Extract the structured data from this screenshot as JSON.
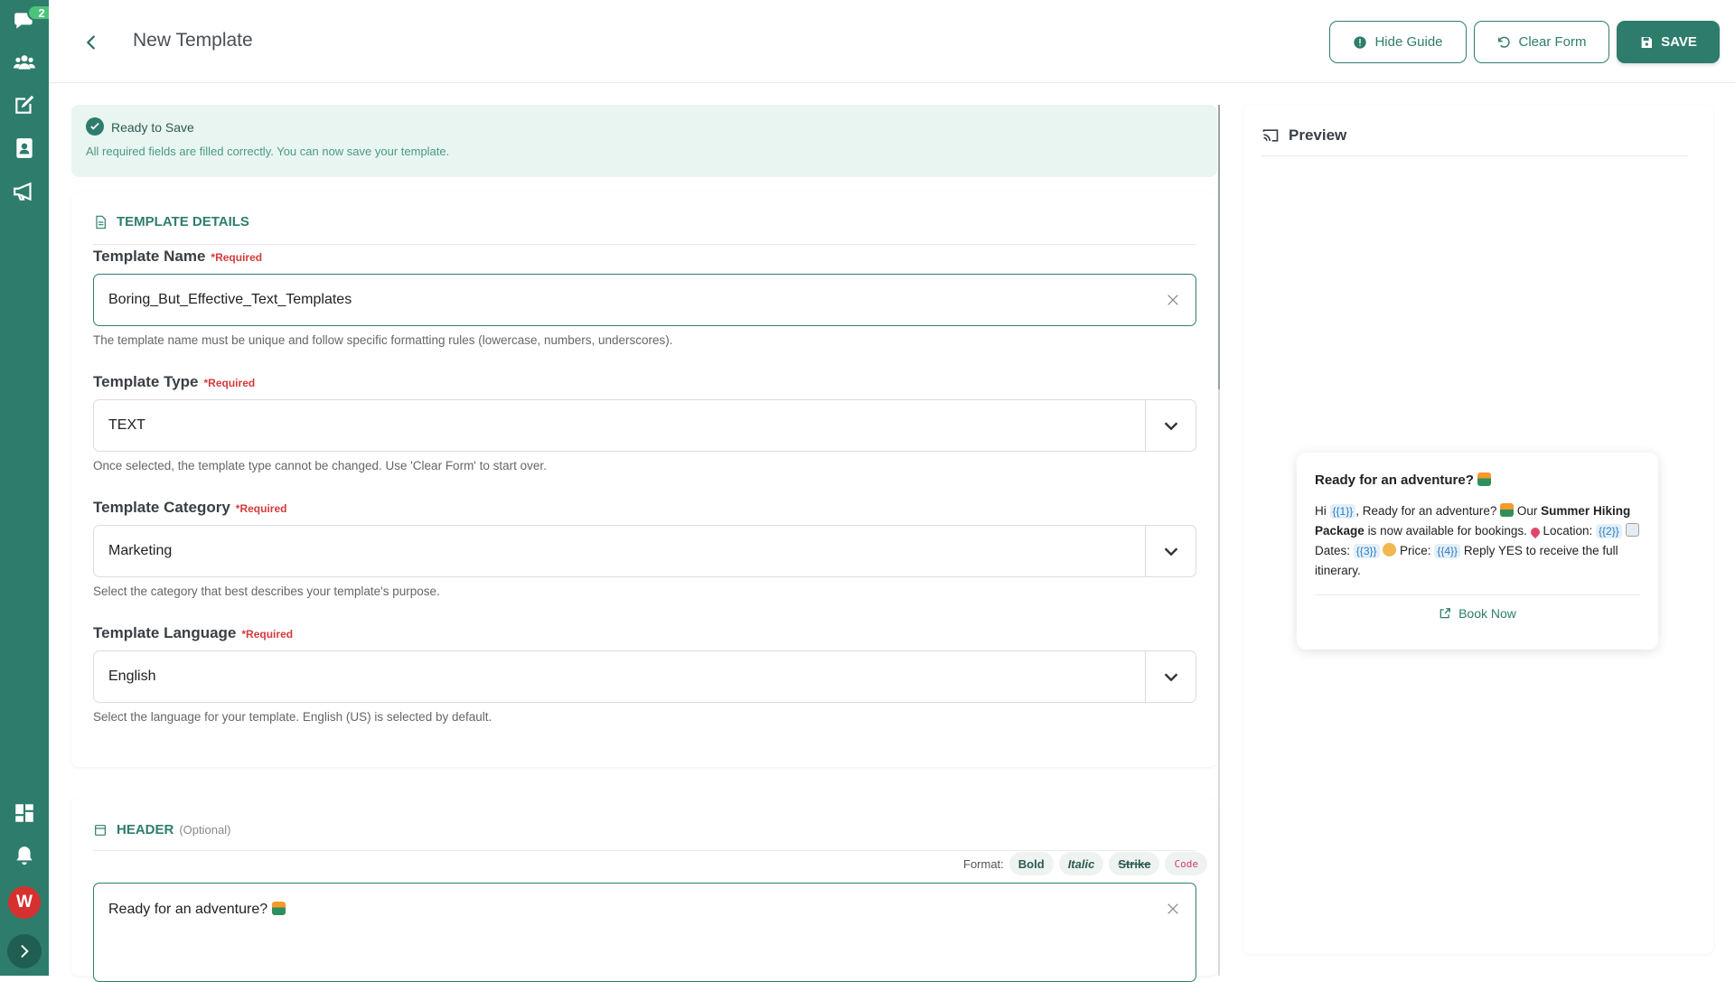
{
  "sidebar": {
    "chat_badge": "2",
    "avatar_letter": "W",
    "items": [
      {
        "icon": "chat-icon"
      },
      {
        "icon": "users-icon"
      },
      {
        "icon": "edit-icon"
      },
      {
        "icon": "contact-icon"
      },
      {
        "icon": "megaphone-icon"
      },
      {
        "icon": "dashboard-icon"
      },
      {
        "icon": "bell-icon"
      }
    ]
  },
  "header": {
    "title": "New Template",
    "hide_guide": "Hide Guide",
    "clear_form": "Clear Form",
    "save": "SAVE"
  },
  "status": {
    "title": "Ready to Save",
    "message": "All required fields are filled correctly. You can now save your template."
  },
  "details": {
    "section_title": "TEMPLATE DETAILS",
    "name": {
      "label": "Template Name",
      "required": "*Required",
      "value": "Boring_But_Effective_Text_Templates",
      "help": "The template name must be unique and follow specific formatting rules (lowercase, numbers, underscores)."
    },
    "type": {
      "label": "Template Type",
      "required": "*Required",
      "value": "TEXT",
      "help": "Once selected, the template type cannot be changed. Use 'Clear Form' to start over."
    },
    "category": {
      "label": "Template Category",
      "required": "*Required",
      "value": "Marketing",
      "help": "Select the category that best describes your template's purpose."
    },
    "language": {
      "label": "Template Language",
      "required": "*Required",
      "value": "English",
      "help": "Select the language for your template. English (US) is selected by default."
    }
  },
  "header_section": {
    "title": "HEADER",
    "optional": "(Optional)",
    "format_label": "Format:",
    "format_bold": "Bold",
    "format_italic": "Italic",
    "format_strike": "Strike",
    "format_code": "Code",
    "value": "Ready for an adventure?"
  },
  "preview": {
    "title": "Preview",
    "msg_title": "Ready for an adventure?",
    "body_hi": "Hi",
    "var1": "{{1}}",
    "body_1": ", Ready for an adventure?",
    "body_our": "Our",
    "body_bold": "Summer",
    "body_bold2": "Hiking Package",
    "body_2": "is now available for bookings.",
    "body_loc": "Location:",
    "var2": "{{2}}",
    "body_dates": "Dates:",
    "var3": "{{3}}",
    "body_price": "Price:",
    "var4": "{{4}}",
    "body_reply": "Reply",
    "body_end": "YES to receive the full itinerary.",
    "button": "Book Now"
  },
  "colors": {
    "brand": "#2e7d6c",
    "required": "#d43b3b",
    "variable": "#2a7ac0"
  }
}
